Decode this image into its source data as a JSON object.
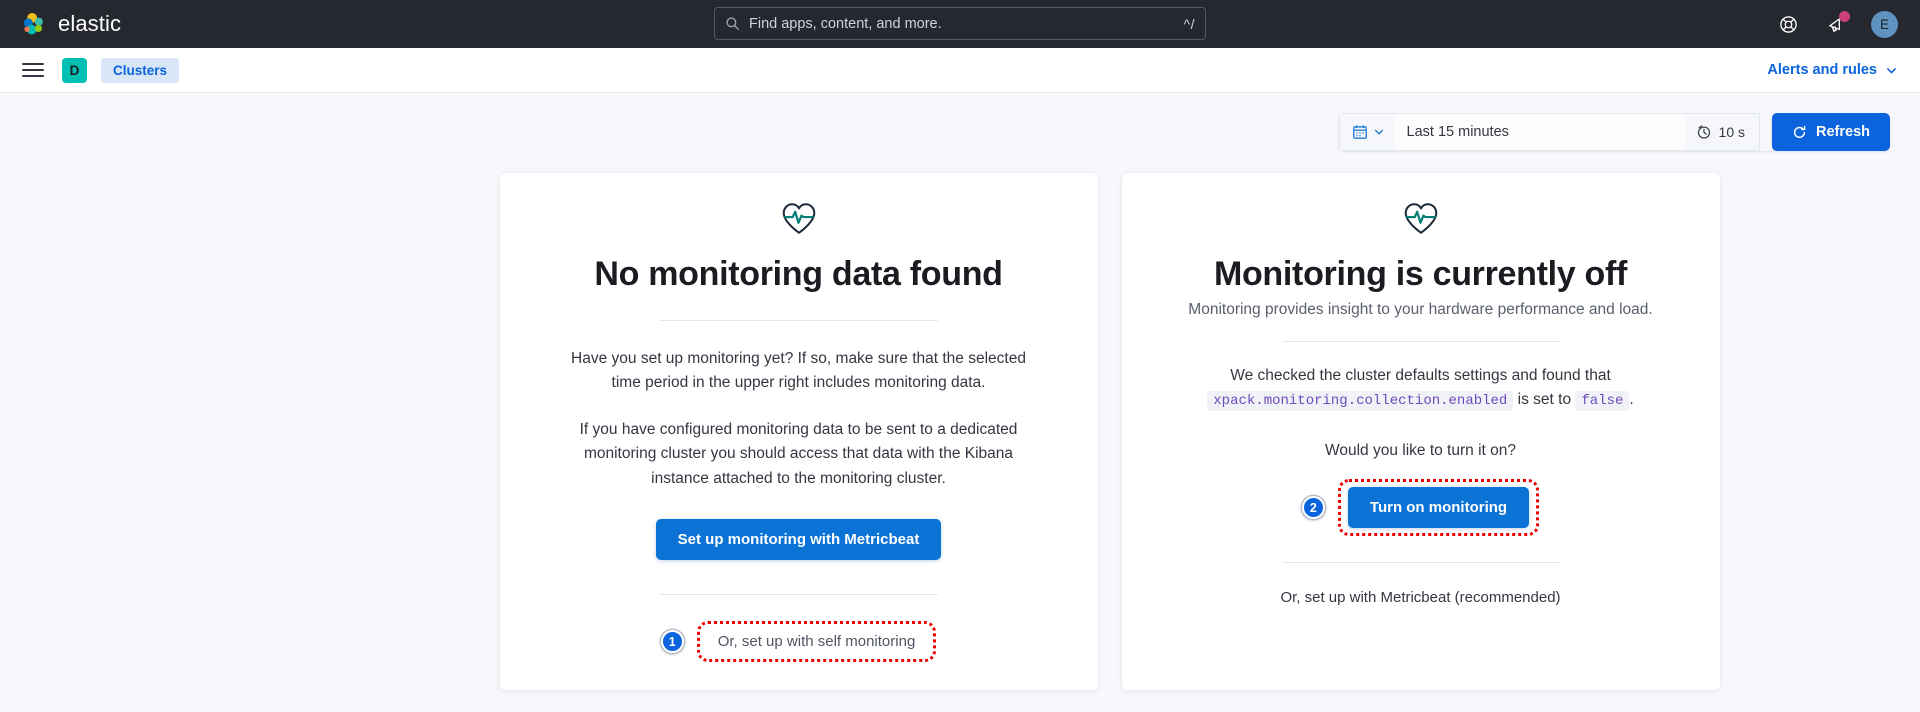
{
  "header": {
    "brand_name": "elastic",
    "search": {
      "placeholder": "Find apps, content, and more.",
      "shortcut_hint": "^/",
      "icon": "search-icon"
    },
    "help_icon": "lifebuoy-help-icon",
    "news_icon": "megaphone-news-icon",
    "news_has_notification": true,
    "user_avatar_initial": "E"
  },
  "navbar": {
    "menu_icon": "hamburger-menu-icon",
    "space_initial": "D",
    "breadcrumb": "Clusters",
    "alerts_and_rules": "Alerts and rules",
    "chevron_icon": "chevron-down-icon"
  },
  "toolbar": {
    "calendar_icon": "calendar-icon",
    "date_range": "Last 15 minutes",
    "refresh_interval_icon": "refresh-interval-clock-icon",
    "refresh_interval": "10 s",
    "refresh_label": "Refresh",
    "refresh_icon": "refresh-circle-icon"
  },
  "left_card": {
    "icon": "heart-pulse-icon",
    "title": "No monitoring data found",
    "paragraph_1": "Have you set up monitoring yet? If so, make sure that the selected time period in the upper right includes monitoring data.",
    "paragraph_2": "If you have configured monitoring data to be sent to a dedicated monitoring cluster you should access that data with the Kibana instance attached to the monitoring cluster.",
    "primary_button": "Set up monitoring with Metricbeat",
    "self_monitoring_link": "Or, set up with self monitoring",
    "annotation_number": "1"
  },
  "right_card": {
    "icon": "heart-pulse-icon",
    "title": "Monitoring is currently off",
    "subtitle": "Monitoring provides insight to your hardware performance and load.",
    "checked_text_prefix": "We checked the cluster defaults settings and found that",
    "setting_key": "xpack.monitoring.collection.enabled",
    "setting_mid_text": "is set to",
    "setting_value": "false",
    "setting_suffix": ".",
    "question": "Would you like to turn it on?",
    "primary_button": "Turn on monitoring",
    "annotation_number": "2",
    "metricbeat_link": "Or, set up with Metricbeat (recommended)"
  },
  "colors": {
    "header_bg": "#25282f",
    "page_bg": "#f7f8fc",
    "accent_blue": "#0b64dd",
    "button_blue": "#0b72d6",
    "space_teal": "#00bfb3",
    "annotation_red": "#ee0000",
    "code_purple": "#6e4bbd",
    "notification_pink": "#ca3f7c"
  }
}
